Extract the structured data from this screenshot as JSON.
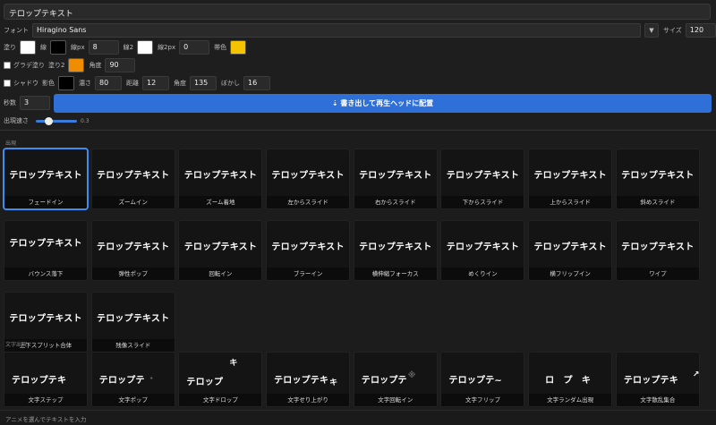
{
  "title_value": "テロップテキスト",
  "font": {
    "label": "フォント",
    "value": "Hiragino Sans",
    "dropdown_icon": "▼",
    "size_label": "サイズ",
    "size_value": "120"
  },
  "style_row": {
    "fill_label": "塗り",
    "fill_color": "#ffffff",
    "line_label": "線",
    "line_color": "#000000",
    "line_px_label": "線px",
    "line_px_value": "8",
    "line2_label": "線2",
    "line2_color": "#ffffff",
    "line2_px_label": "線2px",
    "line2_px_value": "0",
    "band_label": "帯色",
    "band_color": "#f5c400"
  },
  "gradient_row": {
    "gradient_label": "グラデ塗り",
    "fill2_label": "塗り2",
    "fill2_color": "#f08c00",
    "angle_label": "角度",
    "angle_value": "90"
  },
  "shadow_row": {
    "shadow_label": "シャドウ",
    "shadow_color_label": "影色",
    "shadow_color": "#000000",
    "depth_label": "濃さ",
    "depth_value": "80",
    "distance_label": "距離",
    "distance_value": "12",
    "angle_label": "角度",
    "angle_value": "135",
    "blur_label": "ぼかし",
    "blur_value": "16"
  },
  "seconds": {
    "label": "秒数",
    "value": "3"
  },
  "export_button": "⇣ 書き出して再生ヘッドに配置",
  "appear_speed": {
    "label": "出現速さ",
    "value": "0.3",
    "fraction": 0.3
  },
  "section_appear": "出現",
  "preview_text": "テロップテキスト",
  "appear_cards": [
    "フェードイン",
    "ズームイン",
    "ズーム着地",
    "左からスライド",
    "右からスライド",
    "下からスライド",
    "上からスライド",
    "斜めスライド",
    "バウンス落下",
    "弾性ポップ",
    "回転イン",
    "ブラーイン",
    "横伸縮フォーカス",
    "めくりイン",
    "横フリップイン",
    "ワイプ",
    "上下スプリット合体",
    "残像スライド"
  ],
  "section_char": "文字出現",
  "char_cards": [
    {
      "text": "テロップテキ",
      "label": "文字ステップ"
    },
    {
      "text": "テロップテ",
      "label": "文字ポップ"
    },
    {
      "text": "テロップ",
      "label": "文字ドロップ"
    },
    {
      "text": "テロップテキ",
      "label": "文字せり上がり"
    },
    {
      "text": "テロップテ",
      "label": "文字回転イン"
    },
    {
      "text": "テロップテ~",
      "label": "文字フリップ"
    },
    {
      "text": "ロ　プ　キ",
      "label": "文字ランダム出現"
    },
    {
      "text": "テロップテキ",
      "label": "文字散乱集合"
    }
  ],
  "status_text": "アニメを選んでテキストを入力"
}
